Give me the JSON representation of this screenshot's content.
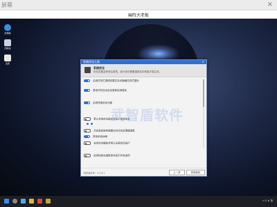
{
  "app": {
    "title": "屏幕",
    "close": "×"
  },
  "header": {
    "caption": "幽阵大老板"
  },
  "desktop_icons": [
    {
      "label": "此电脑",
      "color": "#3a8fd8"
    },
    {
      "label": "回收站",
      "color": "#c9d3e0"
    },
    {
      "label": "设置",
      "color": "#e8e8e8"
    }
  ],
  "window": {
    "titlebar": "系统优化工具",
    "close": "×",
    "header_title": "系统优化",
    "header_desc": "优化设置会修改注册表，部分优化需要重新启动电脑才能生效。",
    "rows": [
      {
        "label": "启用任务栏透明效果并自动隐藏任务栏图标",
        "state": "on",
        "sub": ""
      },
      {
        "label": "禁用开机自动启动更新检测程序",
        "state": "on",
        "sub": ""
      },
      {
        "label": "启用快速启动功能",
        "state": "on",
        "sub": ""
      },
      {
        "label": "禁止系统自动重启并显示错误信息",
        "state": "off",
        "sub": ""
      },
      {
        "label": "开启高性能电源模式并优化处理器调度",
        "state": "off",
        "sub": ""
      },
      {
        "label": "禁用系统休眠",
        "state": "on",
        "sub": ""
      },
      {
        "label": "关闭自动播放并禁止光驱自动运行",
        "state": "off",
        "sub": ""
      },
      {
        "label": "启用经典右键菜单并显示所有选项",
        "state": "off",
        "sub": ""
      }
    ],
    "footer_version": "软件版本号：V 3.6.1",
    "prev_button": "上一步",
    "next_button": "完成优化"
  },
  "watermark": "武智盾软件",
  "colors": {
    "accent": "#2f6fd8",
    "titlebar": "#2e6fd6"
  },
  "taskbar": {
    "tray_text": "∧  ⊡  ⊕  英"
  }
}
